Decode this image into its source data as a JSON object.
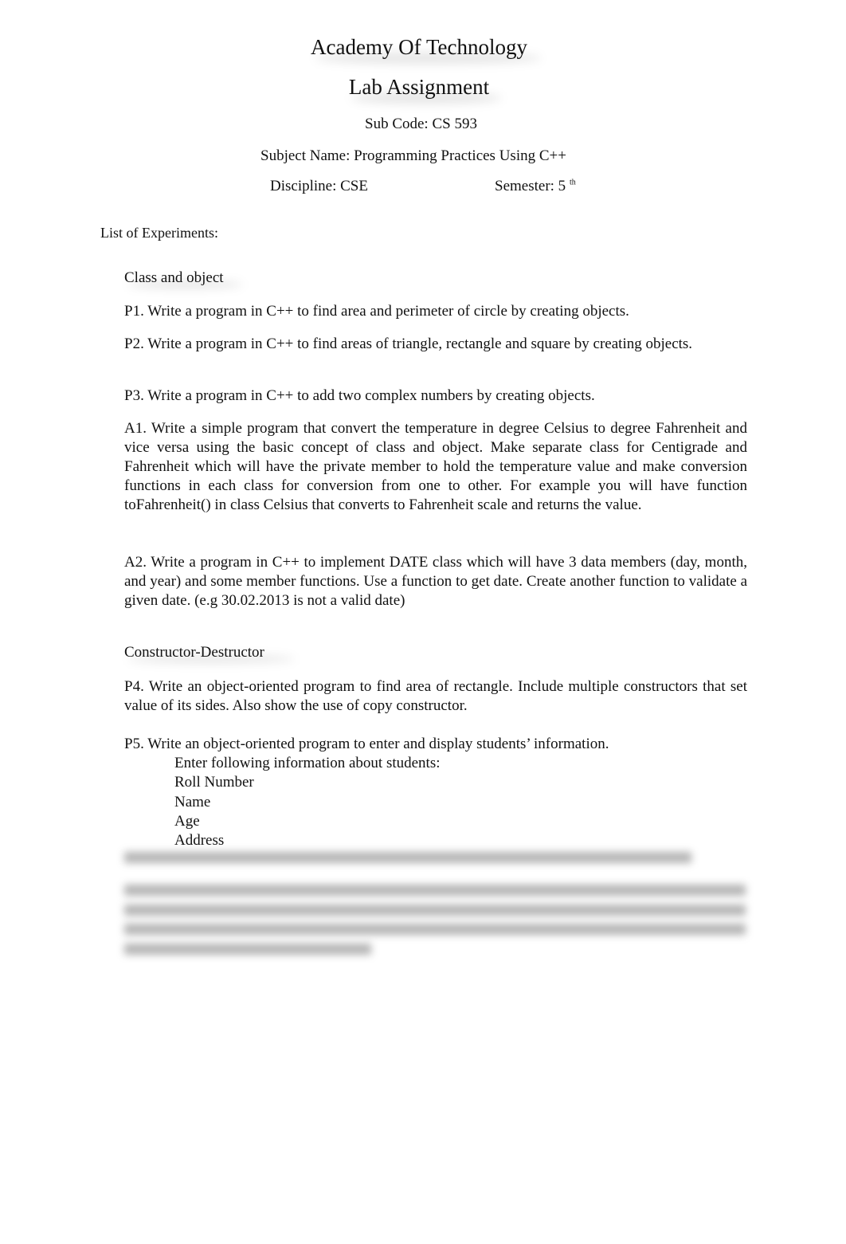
{
  "header": {
    "institution": "Academy Of Technology",
    "doc_title": "Lab Assignment",
    "sub_code": "Sub Code: CS 593",
    "subject_name": "Subject Name: Programming Practices Using C++",
    "discipline": "Discipline: CSE",
    "semester": "Semester: 5",
    "semester_suffix": "th"
  },
  "list_heading": "List of Experiments:",
  "sections": [
    {
      "title": "Class and object",
      "items": [
        "P1. Write a program in C++ to find area and perimeter of circle by creating objects.",
        "P2. Write a program in C++ to find areas of triangle, rectangle and square by creating objects.",
        "P3. Write a program in C++ to add two complex numbers by creating objects.",
        "A1. Write a simple program that convert the temperature in degree Celsius to degree Fahrenheit and vice versa using the basic concept of class and object. Make separate class for Centigrade and Fahrenheit which will have the private member to hold the temperature value and make conversion functions in each class for conversion from one to other. For example you will have function toFahrenheit() in class Celsius that converts to Fahrenheit scale and returns the value.",
        "A2. Write a program in C++ to implement DATE class which will have 3 data members (day, month, and year) and some member functions. Use a function to get date. Create another function to validate a given date. (e.g 30.02.2013 is not a valid date)"
      ]
    },
    {
      "title": "Constructor-Destructor",
      "items": [
        "P4. Write an object-oriented program to find area of rectangle. Include multiple constructors that set value of its sides. Also show the use of copy constructor.",
        "P5. Write an object-oriented program to enter and display students’ information."
      ],
      "p5_sub": [
        "Enter following information about students:",
        "Roll Number",
        "Name",
        "Age",
        "Address"
      ]
    }
  ]
}
